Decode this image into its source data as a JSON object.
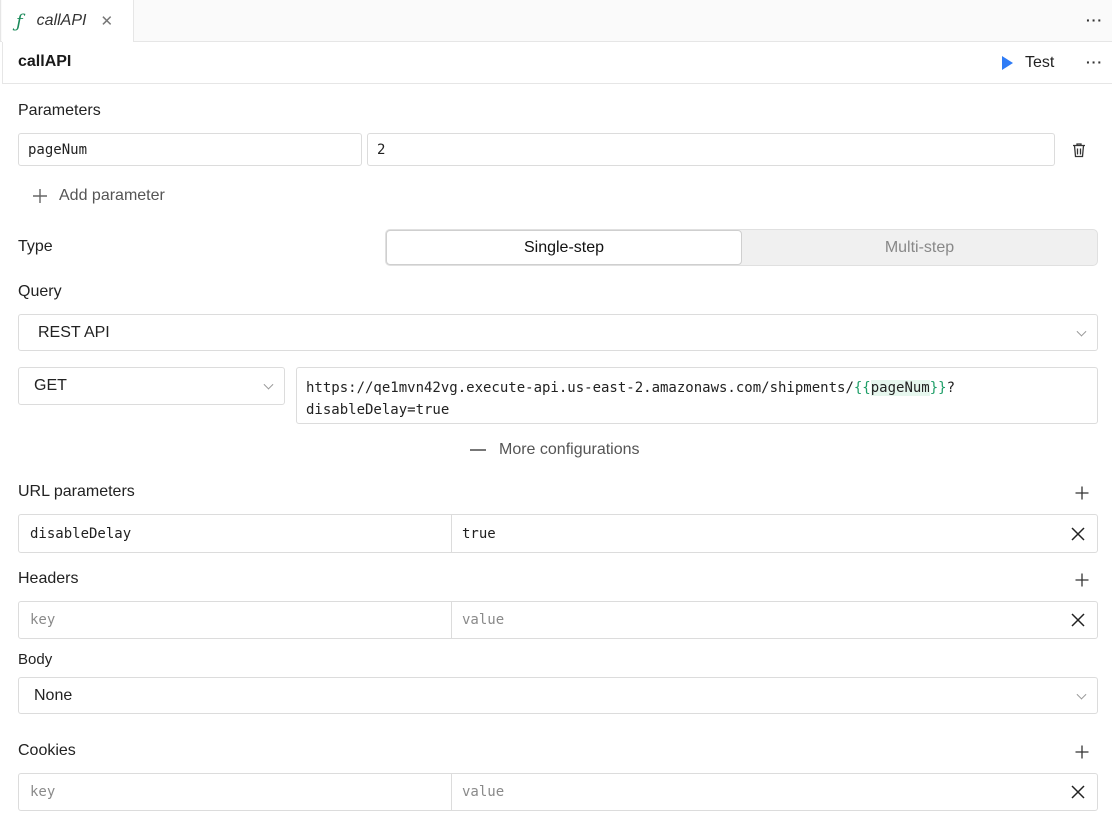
{
  "tab": {
    "icon": "function-icon",
    "name": "callAPI",
    "close": "✕"
  },
  "header": {
    "title": "callAPI",
    "test_label": "Test",
    "more": "···"
  },
  "parameters": {
    "section_label": "Parameters",
    "items": [
      {
        "name": "pageNum",
        "value": "2"
      }
    ],
    "add_label": "Add parameter"
  },
  "type": {
    "label": "Type",
    "options": [
      "Single-step",
      "Multi-step"
    ],
    "selected": "Single-step"
  },
  "query": {
    "label": "Query",
    "resource": "REST API",
    "method": "GET",
    "url_prefix": "https://qe1mvn42vg.execute-api.us-east-2.amazonaws.com/shipments/",
    "url_open": "{{",
    "url_var": "pageNum",
    "url_close": "}}",
    "url_suffix": "?",
    "url_line2": "disableDelay=true",
    "more_configs": "More configurations"
  },
  "url_parameters": {
    "label": "URL parameters",
    "rows": [
      {
        "key": "disableDelay",
        "value": "true"
      }
    ]
  },
  "headers": {
    "label": "Headers",
    "key_placeholder": "key",
    "value_placeholder": "value"
  },
  "body": {
    "label": "Body",
    "selected": "None"
  },
  "cookies": {
    "label": "Cookies",
    "key_placeholder": "key",
    "value_placeholder": "value"
  },
  "colors": {
    "accent": "#2f7cf6",
    "template": "#1f9e68",
    "fx": "#1b8a5a"
  }
}
